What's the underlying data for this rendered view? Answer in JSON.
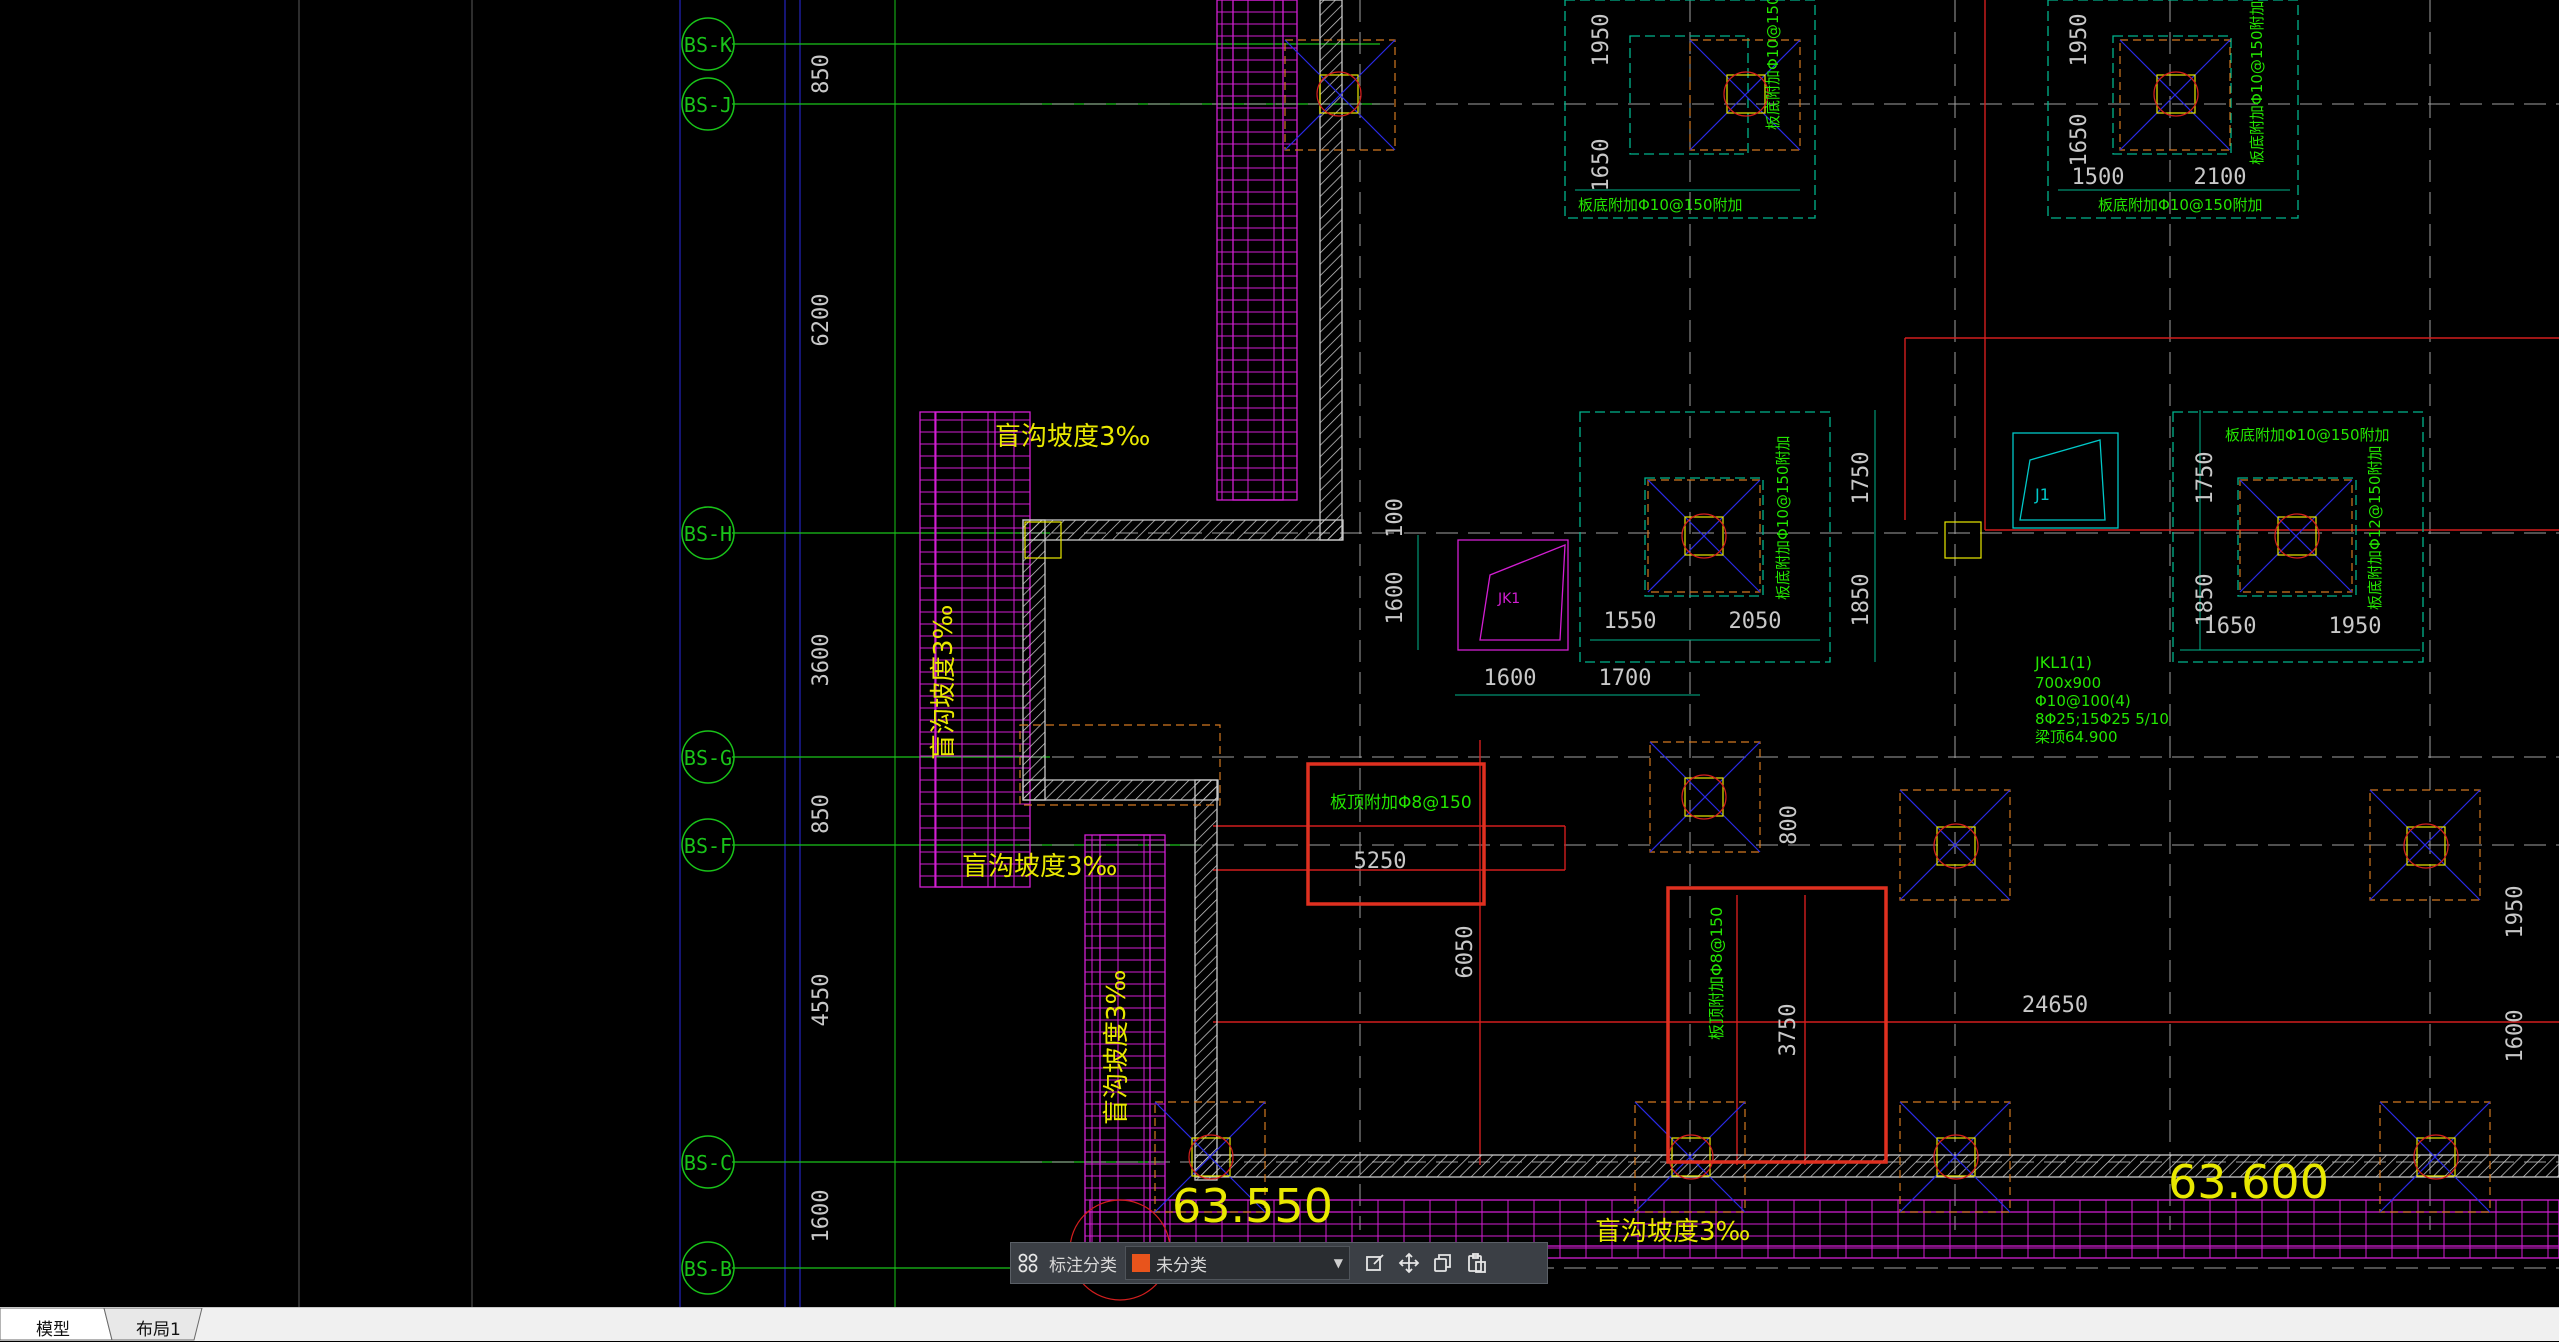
{
  "colors": {
    "axis_green": "#19c319",
    "dim_yellow": "#e8e800",
    "wall_magenta": "#d21ed2",
    "found_cyan": "#00b48c",
    "note_green": "#23e600",
    "beam_red": "#d21e1e",
    "grid_blue": "#2a2ae6",
    "selection_red": "#e03020",
    "axis_label_category": "#e8541c"
  },
  "axes": [
    {
      "label": "BS-K"
    },
    {
      "label": "BS-J"
    },
    {
      "label": "BS-H"
    },
    {
      "label": "BS-G"
    },
    {
      "label": "BS-F"
    },
    {
      "label": "BS-C"
    },
    {
      "label": "BS-B"
    }
  ],
  "vertical_dims": [
    "850",
    "6200",
    "3600",
    "850",
    "4550",
    "1600"
  ],
  "slope_note": "盲沟坡度3‰",
  "annotations": {
    "footing_note": "板底附加Φ10@150附加",
    "footing_note_12": "板底附加Φ12@150附加",
    "plate_note_8": "板顶附加Φ8@150",
    "jkl_title": "JKL1(1)",
    "jkl_lines": [
      "700x900",
      "Φ10@100(4)",
      "8Φ25;15Φ25 5/10",
      "梁顶64.900"
    ],
    "jk1": "JK1",
    "j1": "J1",
    "elev_left": "63.550",
    "elev_right": "63.600"
  },
  "dims": {
    "d1950a": "1950",
    "d1650a": "1650",
    "d1950b": "1950",
    "d1650b": "1650",
    "d1500": "1500",
    "d2100": "2100",
    "d100": "100",
    "d1600a": "1600",
    "d1600b": "1600",
    "d1700": "1700",
    "d1550": "1550",
    "d2050": "2050",
    "d1750a": "1750",
    "d1850a": "1850",
    "d1750b": "1750",
    "d1850b": "1850",
    "d1650c": "1650",
    "d1950c": "1950",
    "d5250": "5250",
    "d6050": "6050",
    "d800": "800",
    "d3750": "3750",
    "d24650": "24650",
    "d1950d": "1950",
    "d1600c": "1600"
  },
  "toolbar": {
    "label": "标注分类",
    "category_value": "未分类"
  },
  "tabs": [
    {
      "label": "模型",
      "active": true
    },
    {
      "label": "布局1",
      "active": false
    }
  ]
}
